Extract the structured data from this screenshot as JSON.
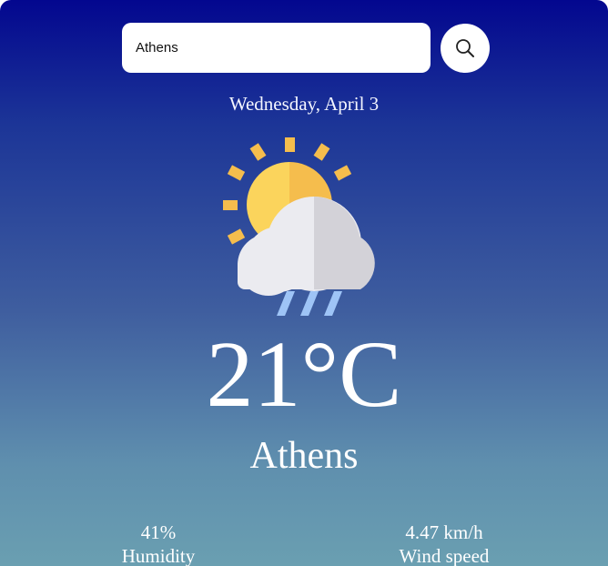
{
  "search": {
    "value": "Athens",
    "icon": "search-icon"
  },
  "date": "Wednesday, April 3",
  "weather": {
    "icon": "sun-cloud-rain-icon",
    "temperature": "21°C",
    "city": "Athens"
  },
  "stats": {
    "humidity": {
      "value": "41%",
      "label": "Humidity"
    },
    "wind": {
      "value": "4.47 km/h",
      "label": "Wind speed"
    }
  },
  "colors": {
    "background_top": "#03078f",
    "background_bottom": "#6a9fb1",
    "sun_light": "#fbd45c",
    "sun_dark": "#f5bd4d",
    "cloud_light": "#ebebf0",
    "cloud_dark": "#d3d2d8",
    "rain": "#9ec4f6"
  }
}
